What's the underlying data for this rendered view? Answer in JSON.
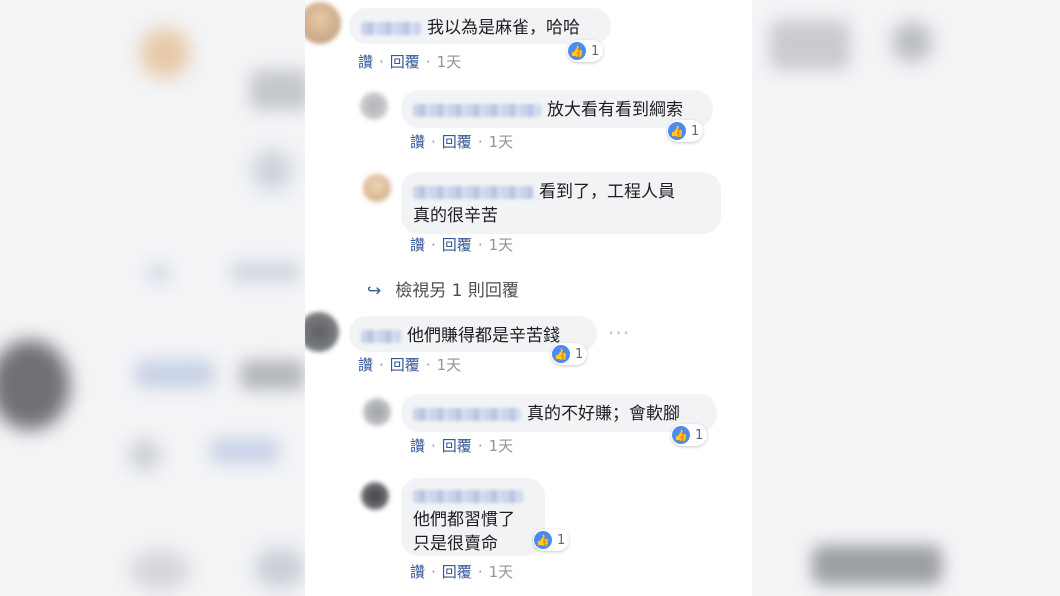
{
  "comments": [
    {
      "text": "我以為是麻雀，哈哈",
      "likes": "1",
      "actions": {
        "like": "讚",
        "reply": "回覆",
        "time": "1天"
      }
    },
    {
      "text": "放大看有看到綱索",
      "likes": "1",
      "actions": {
        "like": "讚",
        "reply": "回覆",
        "time": "1天"
      }
    },
    {
      "text_line1": "看到了，工程人員",
      "text_line2": "真的很辛苦",
      "actions": {
        "like": "讚",
        "reply": "回覆",
        "time": "1天"
      }
    },
    {
      "text": "他們賺得都是辛苦錢",
      "likes": "1",
      "menu": "···",
      "actions": {
        "like": "讚",
        "reply": "回覆",
        "time": "1天"
      }
    },
    {
      "text": "真的不好賺；會軟腳",
      "likes": "1",
      "actions": {
        "like": "讚",
        "reply": "回覆",
        "time": "1天"
      }
    },
    {
      "text_line1": "他們都習慣了",
      "text_line2": "只是很賣命",
      "likes": "1",
      "actions": {
        "like": "讚",
        "reply": "回覆",
        "time": "1天"
      }
    }
  ],
  "more_replies": {
    "arrow": "↪",
    "label": "檢視另 1 則回覆"
  },
  "icons": {
    "like": "thumbs-up-icon",
    "reply_arrow": "reply-arrow-icon"
  },
  "colors": {
    "like_blue": "#4a8af4",
    "bubble": "#f2f3f5",
    "link": "#365899"
  }
}
